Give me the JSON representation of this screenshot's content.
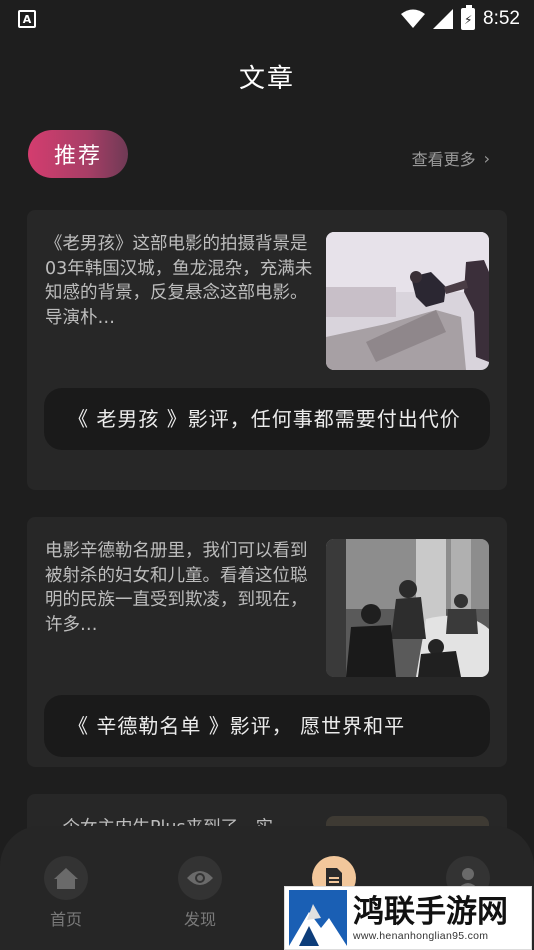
{
  "status_bar": {
    "left_icon": "A",
    "time": "8:52"
  },
  "page_title": "文章",
  "tab": {
    "label": "推荐"
  },
  "see_more": {
    "label": "查看更多",
    "icon": "chevron-right-icon"
  },
  "articles": [
    {
      "excerpt": "《老男孩》这部电影的拍摄背景是03年韩国汉城，鱼龙混杂，充满未知感的背景，反复悬念这部电影。导演朴…",
      "title": "《 老男孩 》影评，任何事都需要付出代价"
    },
    {
      "excerpt": "电影辛德勒名册里，我们可以看到被射杀的妇女和儿童。看着这位聪明的民族一直受到欺凌，到现在，许多…",
      "title": "《 辛德勒名单 》影评， 愿世界和平"
    },
    {
      "excerpt": "…个女主内生Plus来到了…实"
    }
  ],
  "bottom_nav": [
    {
      "label": "首页",
      "icon": "home-icon"
    },
    {
      "label": "发现",
      "icon": "eye-icon"
    },
    {
      "label": "",
      "icon": "document-icon"
    },
    {
      "label": "",
      "icon": "person-icon"
    }
  ],
  "watermark": {
    "title": "鸿联手游网",
    "url": "www.henanhonglian95.com"
  },
  "colors": {
    "background": "#1e1e1e",
    "card": "#272727",
    "accent": "#d43d6f",
    "active_nav": "#f2c79b"
  }
}
